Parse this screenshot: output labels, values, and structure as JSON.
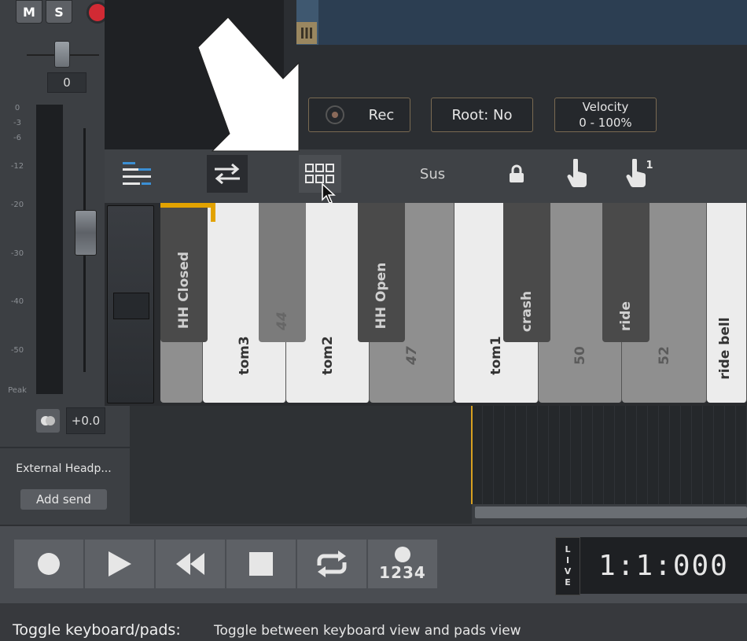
{
  "channel": {
    "mute_label": "M",
    "solo_label": "S",
    "pan_value": "0",
    "db_scale": [
      "0",
      "-3",
      "-6",
      "-12",
      "-20",
      "-30",
      "-40",
      "-50",
      "Peak"
    ],
    "volume_value": "+0.0",
    "output_name": "External Headp...",
    "add_send_label": "Add send"
  },
  "controls": {
    "rec_label": "Rec",
    "root_label": "Root: No",
    "velocity_label": "Velocity",
    "velocity_range": "0 - 100%"
  },
  "toolbar": {
    "sus_label": "Sus",
    "finger_count_label": "1"
  },
  "keyboard": {
    "white_keys": [
      "tom3",
      "tom2",
      "47",
      "tom1",
      "50",
      "52",
      "ride bell"
    ],
    "black_keys": [
      "HH Closed",
      "44",
      "HH Open",
      "crash",
      "ride"
    ]
  },
  "transport": {
    "precount_label": "1234",
    "live_letters": [
      "L",
      "I",
      "V",
      "E"
    ],
    "time": "1:1:000"
  },
  "status": {
    "label": "Toggle keyboard/pads:",
    "description": "Toggle between keyboard view and pads view"
  }
}
